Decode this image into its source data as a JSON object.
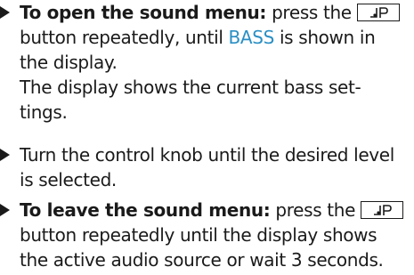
{
  "steps": [
    {
      "lead": "To open the sound menu:",
      "text_a": " press the ",
      "key_icon": "sound-settings-icon",
      "line2_a": "button repeatedly, until ",
      "display_word": "BASS",
      "line2_b": " is shown in",
      "line3": "the display.",
      "line4": "The display shows the current bass set-",
      "line5": "tings."
    },
    {
      "line1": "Turn the control knob until the desired level",
      "line2": "is selected."
    },
    {
      "lead": "To leave the sound menu:",
      "text_a": " press the ",
      "key_icon": "sound-settings-icon",
      "line2": "button repeatedly until the display shows",
      "line3": "the active audio source or wait 3 seconds."
    }
  ]
}
